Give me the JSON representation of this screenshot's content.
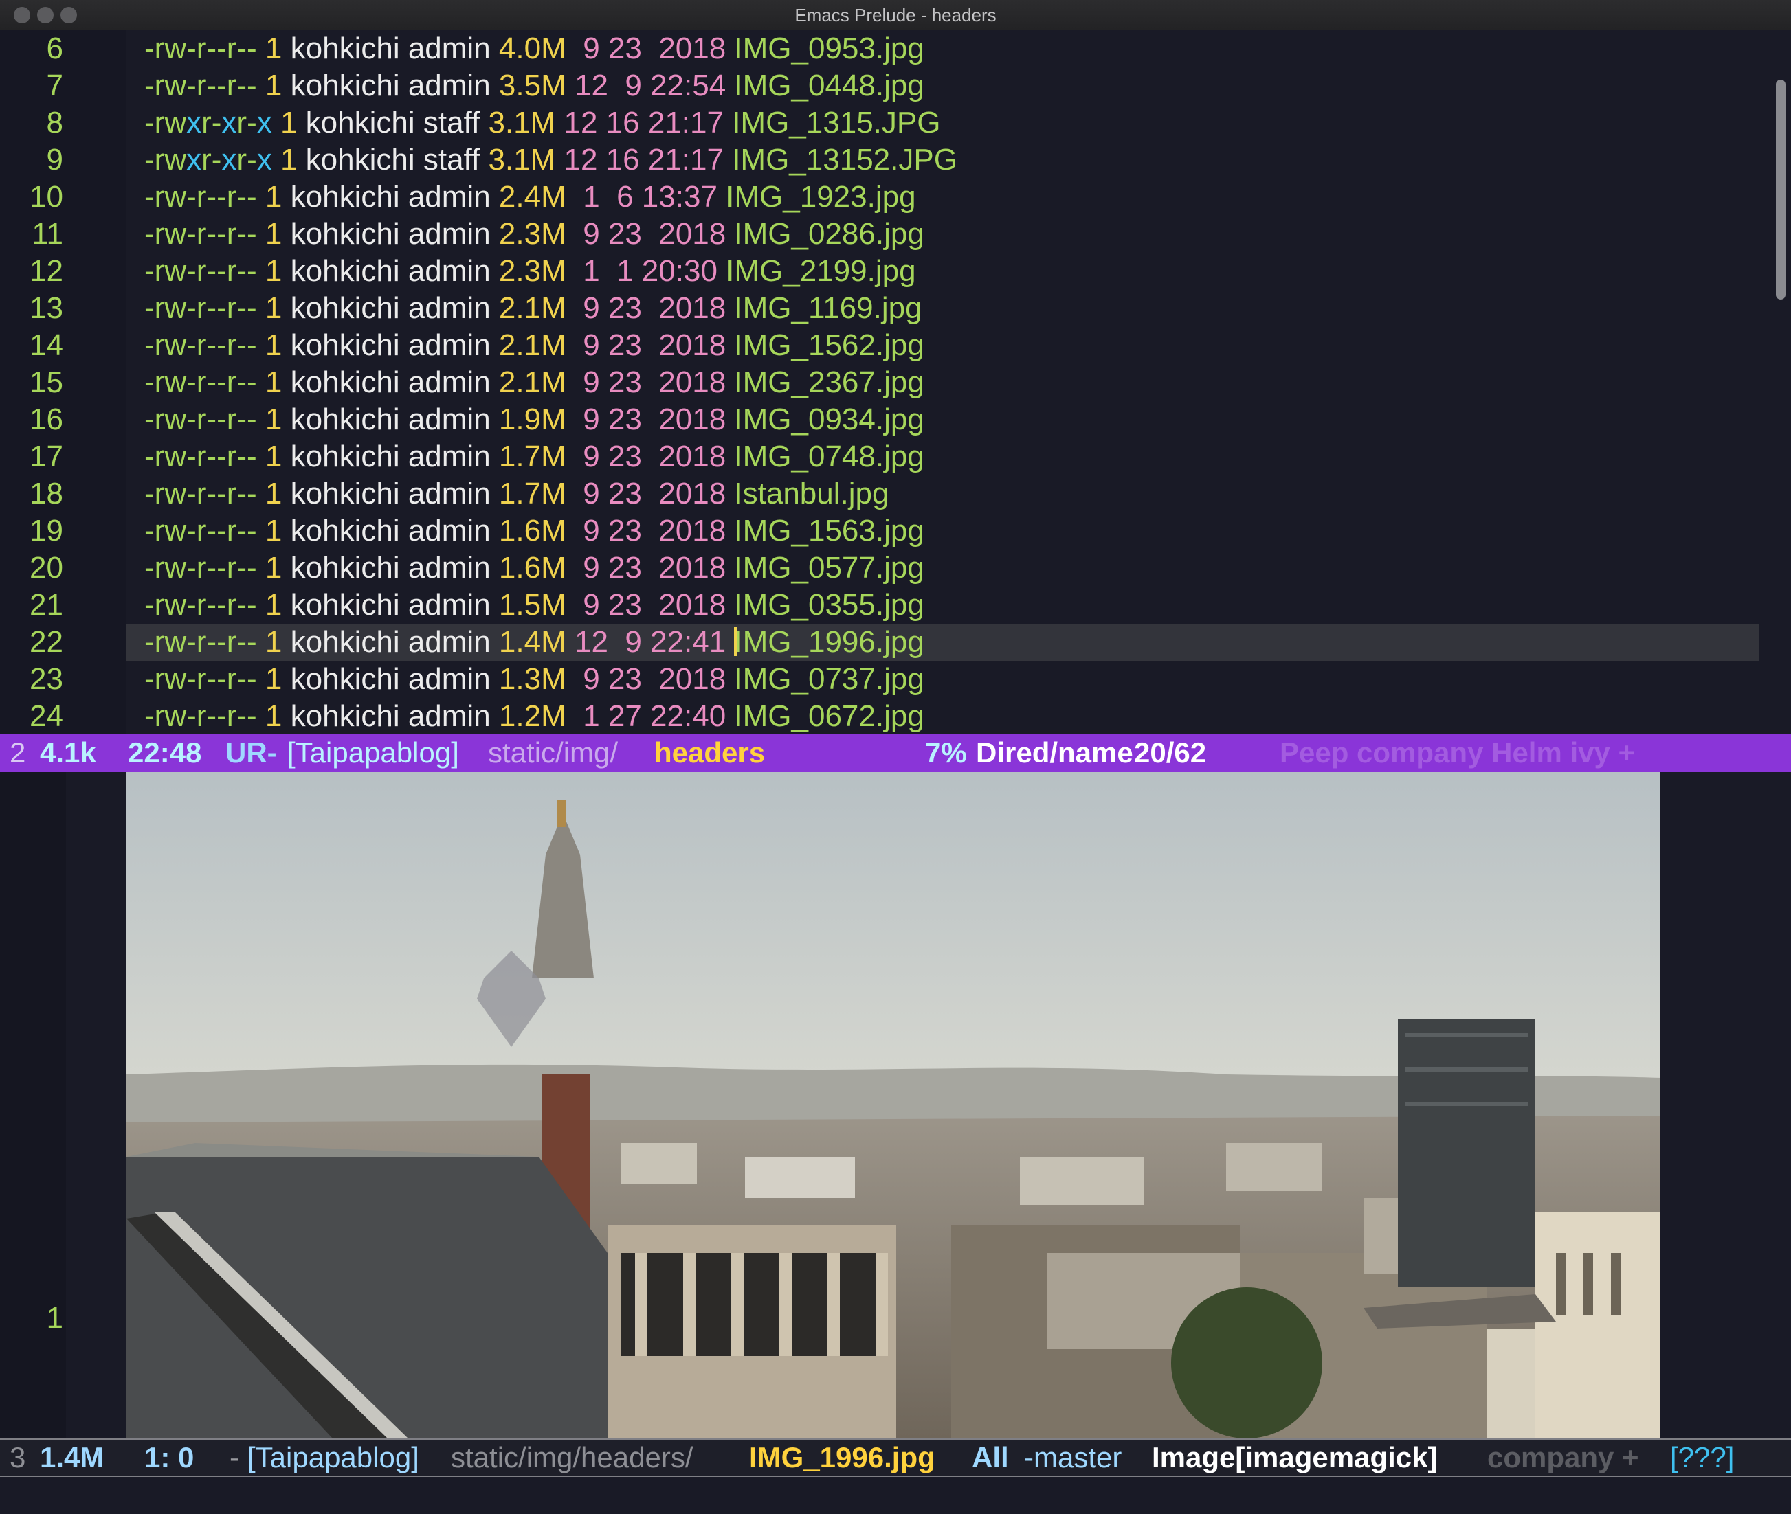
{
  "window": {
    "title": "Emacs Prelude - headers"
  },
  "dired": {
    "rows": [
      {
        "line": "6",
        "perm": "-rw-r--r--",
        "links": "1",
        "owner": "kohkichi admin",
        "size": "4.0M",
        "date": " 9 23  2018",
        "name": "IMG_0953.jpg"
      },
      {
        "line": "7",
        "perm": "-rw-r--r--",
        "links": "1",
        "owner": "kohkichi admin",
        "size": "3.5M",
        "date": "12  9 22:54",
        "name": "IMG_0448.jpg"
      },
      {
        "line": "8",
        "perm": "-rwxr-xr-x",
        "links": "1",
        "owner": "kohkichi staff",
        "size": "3.1M",
        "date": "12 16 21:17",
        "name": "IMG_1315.JPG"
      },
      {
        "line": "9",
        "perm": "-rwxr-xr-x",
        "links": "1",
        "owner": "kohkichi staff",
        "size": "3.1M",
        "date": "12 16 21:17",
        "name": "IMG_13152.JPG"
      },
      {
        "line": "10",
        "perm": "-rw-r--r--",
        "links": "1",
        "owner": "kohkichi admin",
        "size": "2.4M",
        "date": " 1  6 13:37",
        "name": "IMG_1923.jpg"
      },
      {
        "line": "11",
        "perm": "-rw-r--r--",
        "links": "1",
        "owner": "kohkichi admin",
        "size": "2.3M",
        "date": " 9 23  2018",
        "name": "IMG_0286.jpg"
      },
      {
        "line": "12",
        "perm": "-rw-r--r--",
        "links": "1",
        "owner": "kohkichi admin",
        "size": "2.3M",
        "date": " 1  1 20:30",
        "name": "IMG_2199.jpg"
      },
      {
        "line": "13",
        "perm": "-rw-r--r--",
        "links": "1",
        "owner": "kohkichi admin",
        "size": "2.1M",
        "date": " 9 23  2018",
        "name": "IMG_1169.jpg"
      },
      {
        "line": "14",
        "perm": "-rw-r--r--",
        "links": "1",
        "owner": "kohkichi admin",
        "size": "2.1M",
        "date": " 9 23  2018",
        "name": "IMG_1562.jpg"
      },
      {
        "line": "15",
        "perm": "-rw-r--r--",
        "links": "1",
        "owner": "kohkichi admin",
        "size": "2.1M",
        "date": " 9 23  2018",
        "name": "IMG_2367.jpg"
      },
      {
        "line": "16",
        "perm": "-rw-r--r--",
        "links": "1",
        "owner": "kohkichi admin",
        "size": "1.9M",
        "date": " 9 23  2018",
        "name": "IMG_0934.jpg"
      },
      {
        "line": "17",
        "perm": "-rw-r--r--",
        "links": "1",
        "owner": "kohkichi admin",
        "size": "1.7M",
        "date": " 9 23  2018",
        "name": "IMG_0748.jpg"
      },
      {
        "line": "18",
        "perm": "-rw-r--r--",
        "links": "1",
        "owner": "kohkichi admin",
        "size": "1.7M",
        "date": " 9 23  2018",
        "name": "Istanbul.jpg"
      },
      {
        "line": "19",
        "perm": "-rw-r--r--",
        "links": "1",
        "owner": "kohkichi admin",
        "size": "1.6M",
        "date": " 9 23  2018",
        "name": "IMG_1563.jpg"
      },
      {
        "line": "20",
        "perm": "-rw-r--r--",
        "links": "1",
        "owner": "kohkichi admin",
        "size": "1.6M",
        "date": " 9 23  2018",
        "name": "IMG_0577.jpg"
      },
      {
        "line": "21",
        "perm": "-rw-r--r--",
        "links": "1",
        "owner": "kohkichi admin",
        "size": "1.5M",
        "date": " 9 23  2018",
        "name": "IMG_0355.jpg"
      },
      {
        "line": "22",
        "perm": "-rw-r--r--",
        "links": "1",
        "owner": "kohkichi admin",
        "size": "1.4M",
        "date": "12  9 22:41",
        "name": "IMG_1996.jpg",
        "current": true
      },
      {
        "line": "23",
        "perm": "-rw-r--r--",
        "links": "1",
        "owner": "kohkichi admin",
        "size": "1.3M",
        "date": " 9 23  2018",
        "name": "IMG_0737.jpg"
      },
      {
        "line": "24",
        "perm": "-rw-r--r--",
        "links": "1",
        "owner": "kohkichi admin",
        "size": "1.2M",
        "date": " 1 27 22:40",
        "name": "IMG_0672.jpg"
      }
    ]
  },
  "modeline_dired": {
    "window_num": "2",
    "size": "4.1k",
    "time": "22:48",
    "state": "UR-",
    "project": "[Taipapablog]",
    "path": "static/img/",
    "buffer": "headers",
    "percent": "7%",
    "mode": "Dired/name",
    "position": "20/62",
    "minor_modes": "Peep company Helm ivy +"
  },
  "image_pane": {
    "line": "1"
  },
  "modeline_image": {
    "window_num": "3",
    "size": "1.4M",
    "position": "1: 0",
    "state": "-",
    "project": "[Taipapablog]",
    "path": "static/img/headers/",
    "buffer": "IMG_1996.jpg",
    "scroll": "All",
    "vc": "-master",
    "mode": "Image[imagemagick]",
    "minor_modes": "company +",
    "flycheck": "[???]"
  },
  "colors": {
    "background": "#191a26",
    "modeline_active": "#8a35d8",
    "line_number": "#a6d65a",
    "size_yellow": "#f0d24e",
    "date_pink": "#e88cc0",
    "exec_cyan": "#3fc0ef"
  }
}
